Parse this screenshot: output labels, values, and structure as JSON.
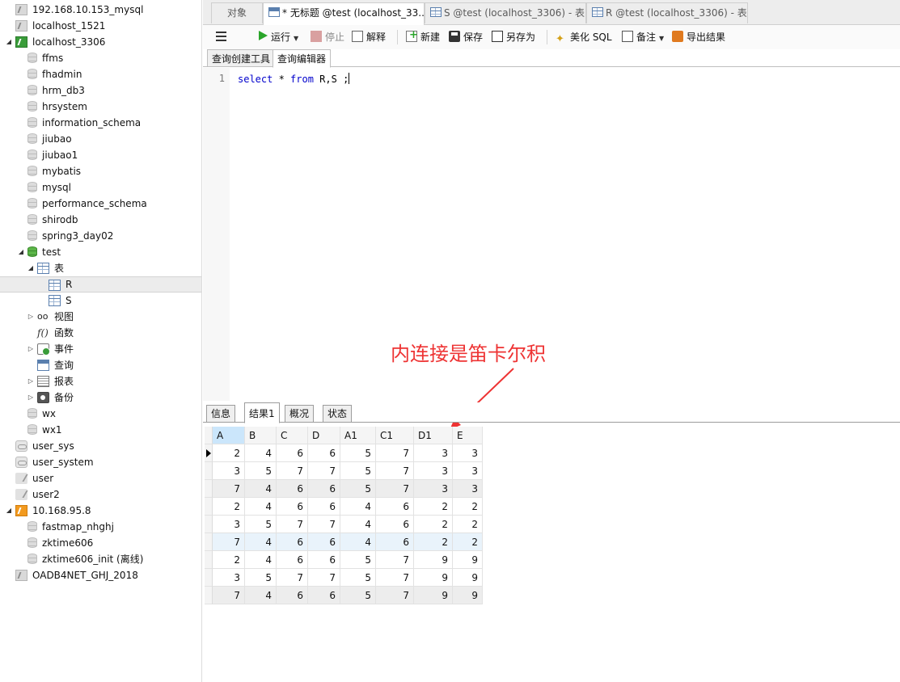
{
  "sidebar": {
    "items": [
      {
        "label": "192.168.10.153_mysql",
        "icon": "connection-gray-icon"
      },
      {
        "label": "localhost_1521",
        "icon": "connection-gray-icon"
      },
      {
        "label": "localhost_3306",
        "icon": "connection-green-icon",
        "expanded": true
      },
      {
        "label": "ffms",
        "icon": "database-icon"
      },
      {
        "label": "fhadmin",
        "icon": "database-icon"
      },
      {
        "label": "hrm_db3",
        "icon": "database-icon"
      },
      {
        "label": "hrsystem",
        "icon": "database-icon"
      },
      {
        "label": "information_schema",
        "icon": "database-icon"
      },
      {
        "label": "jiubao",
        "icon": "database-icon"
      },
      {
        "label": "jiubao1",
        "icon": "database-icon"
      },
      {
        "label": "mybatis",
        "icon": "database-icon"
      },
      {
        "label": "mysql",
        "icon": "database-icon"
      },
      {
        "label": "performance_schema",
        "icon": "database-icon"
      },
      {
        "label": "shirodb",
        "icon": "database-icon"
      },
      {
        "label": "spring3_day02",
        "icon": "database-icon"
      },
      {
        "label": "test",
        "icon": "database-green-icon",
        "expanded": true
      },
      {
        "label": "表",
        "icon": "tables-icon",
        "expanded": true
      },
      {
        "label": "R",
        "icon": "table-icon",
        "selected": true
      },
      {
        "label": "S",
        "icon": "table-icon"
      },
      {
        "label": "视图",
        "icon": "view-icon"
      },
      {
        "label": "函数",
        "icon": "function-icon"
      },
      {
        "label": "事件",
        "icon": "event-icon"
      },
      {
        "label": "查询",
        "icon": "query-icon"
      },
      {
        "label": "报表",
        "icon": "report-icon"
      },
      {
        "label": "备份",
        "icon": "backup-icon"
      },
      {
        "label": "wx",
        "icon": "database-icon"
      },
      {
        "label": "wx1",
        "icon": "database-icon"
      },
      {
        "label": "user_sys",
        "icon": "connection-gray-icon"
      },
      {
        "label": "user_system",
        "icon": "connection-gray-icon"
      },
      {
        "label": "user",
        "icon": "connection-gray-icon"
      },
      {
        "label": "user2",
        "icon": "connection-gray-icon"
      },
      {
        "label": "10.168.95.8",
        "icon": "connection-orange-icon",
        "expanded": true
      },
      {
        "label": "fastmap_nhghj",
        "icon": "database-icon"
      },
      {
        "label": "zktime606",
        "icon": "database-icon"
      },
      {
        "label": "zktime606_init (离线)",
        "icon": "database-icon"
      },
      {
        "label": "OADB4NET_GHJ_2018",
        "icon": "connection-gray-icon"
      }
    ]
  },
  "doc_tabs": [
    {
      "label": "对象"
    },
    {
      "label": "* 无标题 @test (localhost_33...",
      "active": true
    },
    {
      "label": "S @test (localhost_3306) - 表"
    },
    {
      "label": "R @test (localhost_3306) - 表"
    }
  ],
  "toolbar": {
    "run": "运行",
    "stop": "停止",
    "explain": "解释",
    "new": "新建",
    "save": "保存",
    "save_as": "另存为",
    "beautify": "美化 SQL",
    "note": "备注",
    "export": "导出结果"
  },
  "sub_tabs": [
    {
      "label": "查询创建工具"
    },
    {
      "label": "查询编辑器",
      "active": true
    }
  ],
  "editor": {
    "line_number": "1",
    "tokens": [
      {
        "text": "select",
        "type": "keyword"
      },
      {
        "text": " * ",
        "type": "plain"
      },
      {
        "text": "from",
        "type": "keyword"
      },
      {
        "text": " R,S ;",
        "type": "plain"
      }
    ]
  },
  "annotation": {
    "text": "内连接是笛卡尔积",
    "color": "#ee3333"
  },
  "result_tabs": [
    {
      "label": "信息"
    },
    {
      "label": "结果1",
      "active": true
    },
    {
      "label": "概况"
    },
    {
      "label": "状态"
    }
  ],
  "results": {
    "columns": [
      "A",
      "B",
      "C",
      "D",
      "A1",
      "C1",
      "D1",
      "E"
    ],
    "rows": [
      [
        "2",
        "4",
        "6",
        "6",
        "5",
        "7",
        "3",
        "3"
      ],
      [
        "3",
        "5",
        "7",
        "7",
        "5",
        "7",
        "3",
        "3"
      ],
      [
        "7",
        "4",
        "6",
        "6",
        "5",
        "7",
        "3",
        "3"
      ],
      [
        "2",
        "4",
        "6",
        "6",
        "4",
        "6",
        "2",
        "2"
      ],
      [
        "3",
        "5",
        "7",
        "7",
        "4",
        "6",
        "2",
        "2"
      ],
      [
        "7",
        "4",
        "6",
        "6",
        "4",
        "6",
        "2",
        "2"
      ],
      [
        "2",
        "4",
        "6",
        "6",
        "5",
        "7",
        "9",
        "9"
      ],
      [
        "3",
        "5",
        "7",
        "7",
        "5",
        "7",
        "9",
        "9"
      ],
      [
        "7",
        "4",
        "6",
        "6",
        "5",
        "7",
        "9",
        "9"
      ]
    ]
  }
}
